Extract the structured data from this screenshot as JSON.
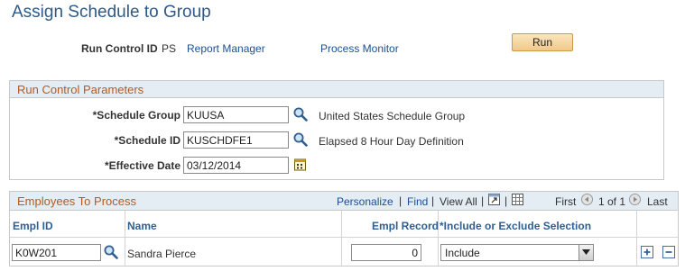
{
  "page": {
    "title": "Assign Schedule to Group"
  },
  "run_control": {
    "label": "Run Control ID",
    "value": "PS",
    "report_manager": "Report Manager",
    "process_monitor": "Process Monitor",
    "run_label": "Run"
  },
  "params": {
    "title": "Run Control Parameters",
    "fields": [
      {
        "label": "*Schedule Group",
        "value": "KUUSA",
        "description": "United States Schedule Group"
      },
      {
        "label": "*Schedule ID",
        "value": "KUSCHDFE1",
        "description": "Elapsed 8 Hour Day Definition"
      },
      {
        "label": "*Effective Date",
        "value": "03/12/2014"
      }
    ]
  },
  "employees": {
    "title": "Employees To Process",
    "toolbar": {
      "personalize": "Personalize",
      "find": "Find",
      "view_all": "View All",
      "first": "First",
      "range": "1 of 1",
      "last": "Last"
    },
    "columns": [
      "Empl ID",
      "Name",
      "Empl Record",
      "*Include or Exclude Selection"
    ],
    "rows": [
      {
        "empl_id": "K0W201",
        "name": "Sandra Pierce",
        "empl_record": "0",
        "selection": "Include"
      }
    ]
  }
}
